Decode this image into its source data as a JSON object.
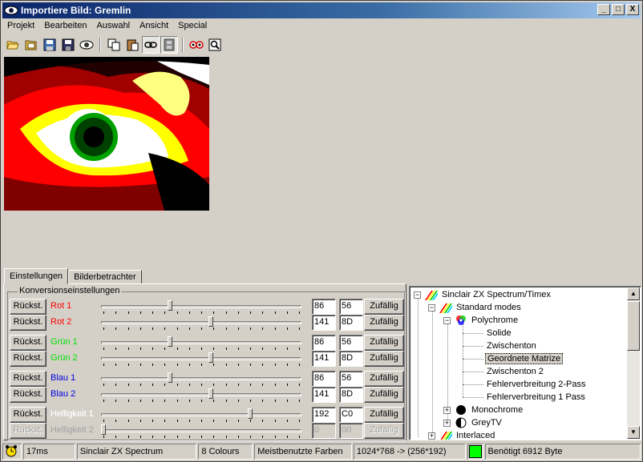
{
  "window": {
    "title": "Importiere Bild: Gremlin",
    "controls": {
      "minimize": "_",
      "maximize": "□",
      "close": "X"
    }
  },
  "menu": [
    "Projekt",
    "Bearbeiten",
    "Auswahl",
    "Ansicht",
    "Special"
  ],
  "toolbar": [
    "open-folder-icon",
    "open-icon",
    "save-as-icon",
    "save-icon",
    "view-icon",
    "copy-icon",
    "paste-icon",
    "link-icon",
    "film-icon",
    "compare-icon",
    "zoom-icon"
  ],
  "tabs": [
    {
      "label": "Einstellungen",
      "active": true
    },
    {
      "label": "Bilderbetrachter",
      "active": false
    }
  ],
  "conversion": {
    "group_title": "Konversionseinstellungen",
    "reset_label": "Rückst.",
    "random_label": "Zufällig",
    "rows": [
      {
        "label": "Rot 1",
        "color": "#ff0000",
        "dec": "86",
        "hex": "56",
        "level": 0.34,
        "enabled": true
      },
      {
        "label": "Rot 2",
        "color": "#ff0000",
        "dec": "141",
        "hex": "8D",
        "level": 0.55,
        "enabled": true
      },
      {
        "label": "Grün 1",
        "color": "#00e000",
        "dec": "86",
        "hex": "56",
        "level": 0.34,
        "enabled": true
      },
      {
        "label": "Grün 2",
        "color": "#00e000",
        "dec": "141",
        "hex": "8D",
        "level": 0.55,
        "enabled": true
      },
      {
        "label": "Blau 1",
        "color": "#0000e0",
        "dec": "86",
        "hex": "56",
        "level": 0.34,
        "enabled": true
      },
      {
        "label": "Blau 2",
        "color": "#0000e0",
        "dec": "141",
        "hex": "8D",
        "level": 0.55,
        "enabled": true
      },
      {
        "label": "Helligkeit 1",
        "color": "#ffffff",
        "dec": "192",
        "hex": "C0",
        "level": 0.75,
        "enabled": true
      },
      {
        "label": "Helligkeit 2",
        "color": "#a0a0a0",
        "dec": "0",
        "hex": "00",
        "level": 0.0,
        "enabled": false
      }
    ]
  },
  "tree": {
    "root": "Sinclair ZX Spectrum/Timex",
    "standard": "Standard modes",
    "polychrome": "Polychrome",
    "leaves": [
      "Solide",
      "Zwischenton",
      "Geordnete Matrize",
      "Zwischenton 2",
      "Fehlerverbreitung 2-Pass",
      "Fehlerverbreitung 1 Pass"
    ],
    "selected": "Geordnete Matrize",
    "monochrome": "Monochrome",
    "greytv": "GreyTV",
    "interlaced": "Interlaced",
    "expand_plus": "+",
    "expand_minus": "−"
  },
  "status": {
    "time": "17ms",
    "machine": "Sinclair ZX Spectrum",
    "colours": "8 Colours",
    "palette": "Meistbenutzte Farben",
    "resolution": "1024*768 -> (256*192)",
    "ok_color": "#00ff00",
    "bytes": "Benötigt 6912 Byte"
  }
}
